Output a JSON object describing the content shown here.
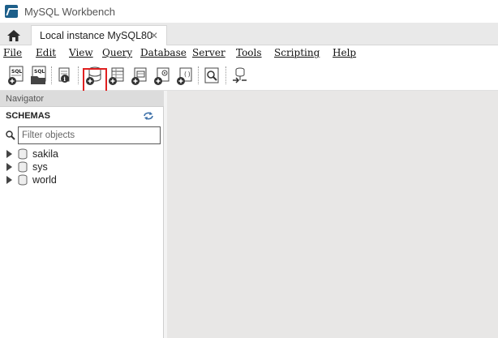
{
  "window": {
    "title": "MySQL Workbench"
  },
  "tabs": {
    "home_icon": "home-icon",
    "active_tab": "Local instance MySQL80",
    "close_glyph": "✕"
  },
  "menu": [
    "File",
    "Edit",
    "View",
    "Query",
    "Database",
    "Server",
    "Tools",
    "Scripting",
    "Help"
  ],
  "toolbar": {
    "buttons": [
      "new-sql-tab-icon",
      "open-sql-script-icon",
      "schema-inspector-icon",
      "create-schema-icon",
      "create-table-icon",
      "create-view-icon",
      "create-procedure-icon",
      "create-function-icon",
      "table-data-search-icon",
      "reconnect-icon"
    ],
    "highlighted_button": "create-schema-icon",
    "highlight_color": "#e02020"
  },
  "navigator": {
    "header": "Navigator",
    "schemas_title": "SCHEMAS",
    "filter_placeholder": "Filter objects",
    "schemas": [
      "sakila",
      "sys",
      "world"
    ]
  }
}
